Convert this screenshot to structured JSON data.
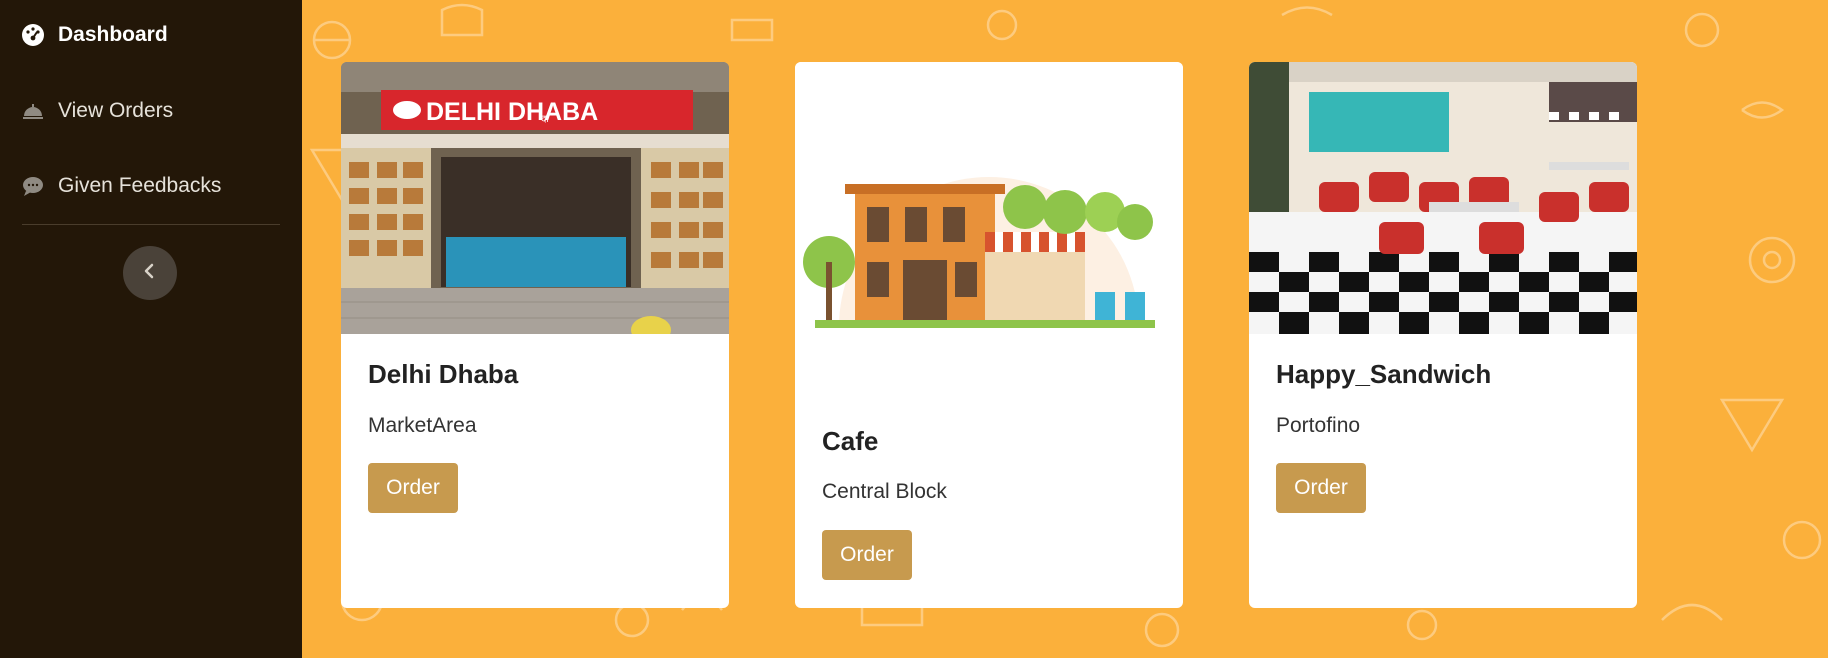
{
  "sidebar": {
    "items": [
      {
        "label": "Dashboard",
        "icon": "dashboard-gauge-icon"
      },
      {
        "label": "View Orders",
        "icon": "cloche-icon"
      },
      {
        "label": "Given Feedbacks",
        "icon": "chat-bubble-icon"
      }
    ],
    "collapse_icon": "chevron-left-icon"
  },
  "restaurants": [
    {
      "name": "Delhi Dhaba",
      "location": "MarketArea",
      "button": "Order",
      "sign_text": "DELHI DHABA",
      "sign_small": "दा"
    },
    {
      "name": "Cafe",
      "location": "Central Block",
      "button": "Order"
    },
    {
      "name": "Happy_Sandwich",
      "location": "Portofino",
      "button": "Order"
    }
  ],
  "colors": {
    "sidebar_bg": "#231708",
    "main_bg": "#fbb03b",
    "button": "#c79a4e",
    "card_bg": "#ffffff"
  }
}
